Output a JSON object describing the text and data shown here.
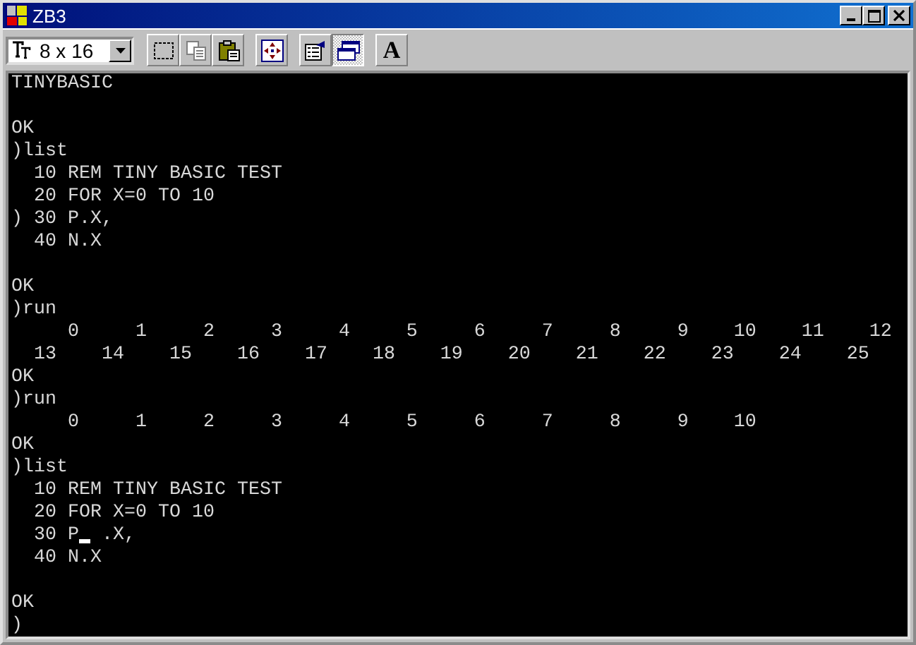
{
  "window": {
    "title": "ZB3"
  },
  "toolbar": {
    "font_size": {
      "value": "8 x 16"
    },
    "groups": [
      [
        {
          "kind": "select",
          "pressed": false
        },
        {
          "kind": "copy",
          "pressed": false
        },
        {
          "kind": "paste",
          "pressed": false
        }
      ],
      [
        {
          "kind": "move",
          "pressed": false
        }
      ],
      [
        {
          "kind": "properties",
          "pressed": false
        },
        {
          "kind": "window",
          "pressed": true
        }
      ],
      [
        {
          "kind": "font",
          "label": "A",
          "pressed": false
        }
      ]
    ]
  },
  "terminal": {
    "blocks": [
      [
        {
          "text": "TINYBASIC"
        }
      ],
      [
        {
          "text": "OK"
        },
        {
          "text": ")list"
        },
        {
          "text": "  10 REM TINY BASIC TEST"
        },
        {
          "text": "  20 FOR X=0 TO 10"
        },
        {
          "text": ") 30 P.X,"
        },
        {
          "text": "  40 N.X"
        }
      ],
      [
        {
          "text": "OK"
        },
        {
          "text": ")run"
        },
        {
          "text": "     0     1     2     3     4     5     6     7     8     9    10    11    12"
        },
        {
          "text": "  13    14    15    16    17    18    19    20    21    22    23    24    25"
        },
        {
          "text": "OK"
        },
        {
          "text": ")run"
        },
        {
          "text": "     0     1     2     3     4     5     6     7     8     9    10"
        },
        {
          "text": "OK"
        },
        {
          "text": ")list"
        },
        {
          "text": "  10 REM TINY BASIC TEST"
        },
        {
          "text": "  20 FOR X=0 TO 10"
        },
        {
          "text": "  30 P",
          "cursor": true,
          "after": " .X,"
        },
        {
          "text": "  40 N.X"
        }
      ],
      [
        {
          "text": "OK"
        },
        {
          "text": ")"
        }
      ]
    ]
  }
}
